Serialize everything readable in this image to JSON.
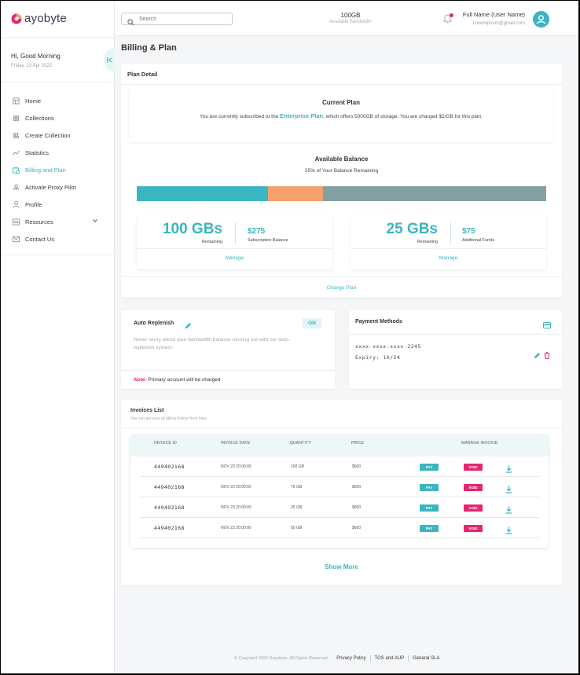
{
  "brand": {
    "name": "ayobyte",
    "accent": "#3bb5bf",
    "pink": "#e6266e"
  },
  "sidebar": {
    "greeting": "Hi, Good Morning",
    "date": "Friday, 13 Apr 2022",
    "items": [
      {
        "label": "Home",
        "icon": "home-icon"
      },
      {
        "label": "Collections",
        "icon": "collections-icon"
      },
      {
        "label": "Create Collection",
        "icon": "create-collection-icon"
      },
      {
        "label": "Statistics",
        "icon": "statistics-icon"
      },
      {
        "label": "Billing and Plan",
        "icon": "billing-icon",
        "active": true
      },
      {
        "label": "Activate Proxy Pilot",
        "icon": "proxy-pilot-icon"
      },
      {
        "label": "Profile",
        "icon": "profile-icon"
      },
      {
        "label": "Resources",
        "icon": "resources-icon"
      },
      {
        "label": "Contact Us",
        "icon": "mail-icon"
      }
    ]
  },
  "topbar": {
    "search_placeholder": "Search",
    "bandwidth_value": "100GB",
    "bandwidth_label": "Available Bandwidth",
    "user_name": "Full Name (User Name)",
    "user_email": "Loremipsum@gmail.com"
  },
  "page": {
    "title": "Billing & Plan"
  },
  "plan": {
    "heading": "Plan Detail",
    "current_title": "Current Plan",
    "current_text_pre": "You are currently subscribed to the ",
    "current_plan_name": "Enterprise Plan",
    "current_text_post": ", which offers 5000GB of storage. You are charged $2/GB for this plan.",
    "balance_title": "Available Balance",
    "balance_sub": "25% of Your Balance Remaining",
    "balance_bar": [
      {
        "name": "used",
        "fraction": 0.32,
        "color": "#3bb5bf"
      },
      {
        "name": "funds",
        "fraction": 0.135,
        "color": "#f4a16c"
      },
      {
        "name": "remaining",
        "fraction": 0.545,
        "color": "#84a0a1"
      }
    ],
    "stats": [
      {
        "big": "100 GBs",
        "big_label": "Remaining",
        "amount": "$275",
        "amount_label": "Subscription Balance",
        "manage": "Manage"
      },
      {
        "big": "25 GBs",
        "big_label": "Remaining",
        "amount": "$75",
        "amount_label": "Additional Funds",
        "manage": "Manage"
      }
    ],
    "change_plan": "Change Plan"
  },
  "replenish": {
    "title": "Auto Replenish",
    "status": "ON",
    "description": "Never worry about your bandwidth balance running out with our auto-replenish system.",
    "note_label": "Note:",
    "note_text": " Primary account will be charged"
  },
  "payment": {
    "title": "Payment Methods",
    "card_number": "xxxx-xxxx-xxxx-2245",
    "expiry": "Expiry: 10/24"
  },
  "invoices": {
    "title": "Invoices List",
    "subtitle": "You can get your all billing history from here.",
    "columns": [
      "INVOICE ID",
      "INVOICE DATE",
      "QUANTITY",
      "PRICE",
      "MANAGE INVOICE"
    ],
    "rows": [
      {
        "id": "449402168",
        "date": "NOV 23 20:00:00",
        "quantity": "100 GB",
        "price": "$600",
        "pay": "PAY",
        "void": "VOID"
      },
      {
        "id": "449402168",
        "date": "NOV 23 20:00:00",
        "quantity": "75 GB",
        "price": "$600",
        "pay": "PAY",
        "void": "VOID"
      },
      {
        "id": "449402168",
        "date": "NOV 23 20:00:00",
        "quantity": "25 GB",
        "price": "$600",
        "pay": "PAY",
        "void": "VOID"
      },
      {
        "id": "449402168",
        "date": "NOV 23 20:00:00",
        "quantity": "50 GB",
        "price": "$600",
        "pay": "PAY",
        "void": "VOID"
      }
    ],
    "show_more": "Show More"
  },
  "footer": {
    "copyright": "© Copyright 2022 Rayobyte. All Rights Reserved.",
    "links": [
      "Privacy Policy",
      "TOS and AUP",
      "General SLA"
    ]
  }
}
